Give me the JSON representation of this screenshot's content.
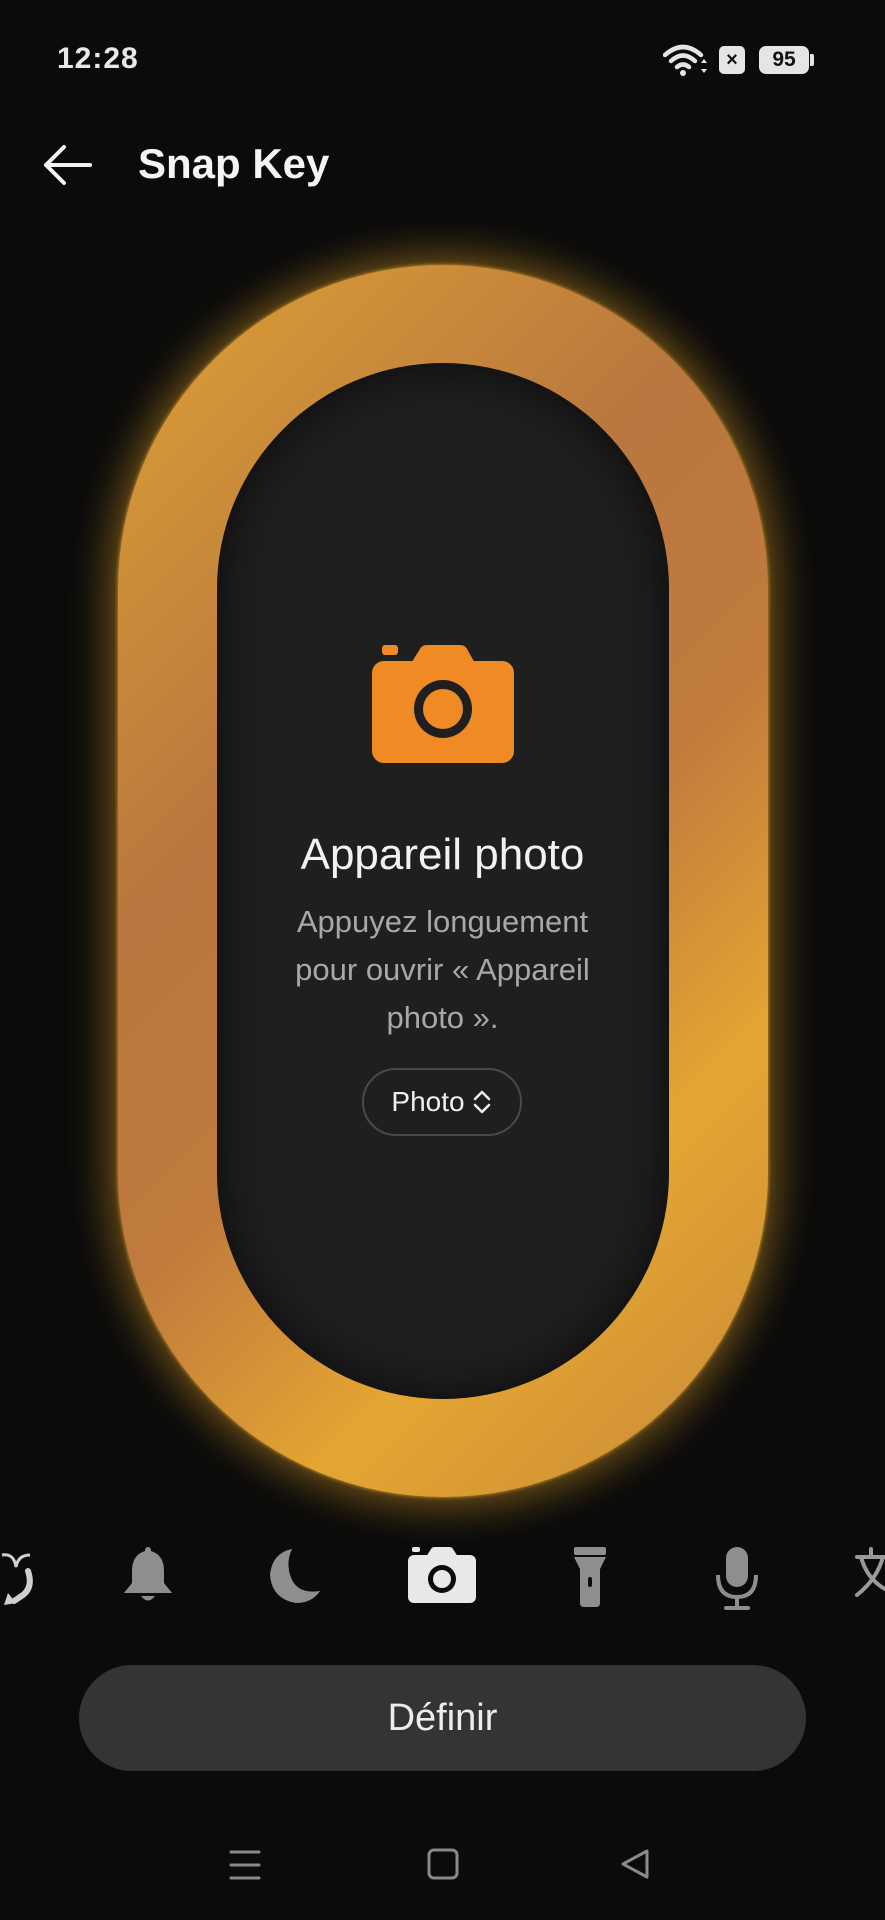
{
  "status_bar": {
    "time": "12:28",
    "battery_level": "95",
    "icons": [
      "wifi-icon",
      "no-sim-icon",
      "battery-icon"
    ]
  },
  "header": {
    "title": "Snap Key",
    "back_icon": "arrow-left-icon"
  },
  "feature": {
    "icon": "camera-icon",
    "title": "Appareil photo",
    "description": "Appuyez longuement pour ouvrir « Appareil photo ».",
    "mode_label": "Photo",
    "mode_icon": "up-down-chevron-icon"
  },
  "shortcut_strip": {
    "items": [
      {
        "icon": "sparkle-refresh-icon",
        "selected": false
      },
      {
        "icon": "bell-icon",
        "selected": false
      },
      {
        "icon": "moon-icon",
        "selected": false
      },
      {
        "icon": "camera-icon",
        "selected": true
      },
      {
        "icon": "flashlight-icon",
        "selected": false
      },
      {
        "icon": "microphone-icon",
        "selected": false
      },
      {
        "icon": "translate-icon",
        "selected": false
      }
    ]
  },
  "action": {
    "define_label": "Définir"
  },
  "navigation": {
    "icons": [
      "menu-icon",
      "home-square-icon",
      "back-triangle-icon"
    ]
  },
  "colors": {
    "accent_orange": "#F08A24",
    "ring_gold": "#E0A030",
    "background": "#0B0B0B",
    "panel": "#1F1F1F"
  }
}
